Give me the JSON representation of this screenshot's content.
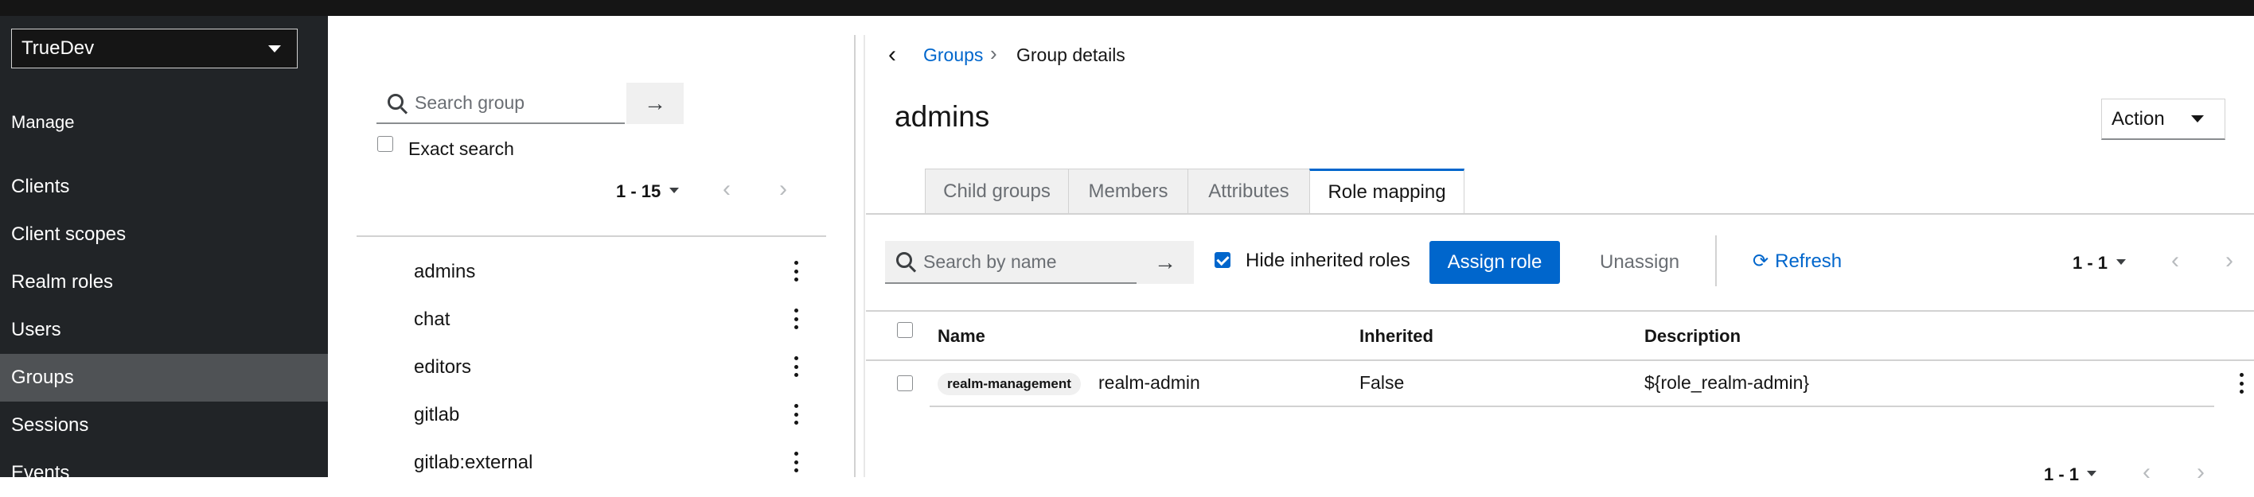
{
  "realm": {
    "selected": "TrueDev"
  },
  "sidebar": {
    "section": "Manage",
    "items": [
      {
        "label": "Clients"
      },
      {
        "label": "Client scopes"
      },
      {
        "label": "Realm roles"
      },
      {
        "label": "Users"
      },
      {
        "label": "Groups"
      },
      {
        "label": "Sessions"
      },
      {
        "label": "Events"
      }
    ]
  },
  "tree": {
    "search_placeholder": "Search group",
    "exact_search_label": "Exact search",
    "pagination": "1 - 15",
    "items": [
      {
        "label": "admins"
      },
      {
        "label": "chat"
      },
      {
        "label": "editors"
      },
      {
        "label": "gitlab"
      },
      {
        "label": "gitlab:external"
      }
    ]
  },
  "breadcrumb": {
    "parent": "Groups",
    "current": "Group details"
  },
  "details": {
    "title": "admins",
    "action_label": "Action",
    "tabs": [
      {
        "label": "Child groups"
      },
      {
        "label": "Members"
      },
      {
        "label": "Attributes"
      },
      {
        "label": "Role mapping"
      }
    ],
    "active_tab": "Role mapping"
  },
  "role_mapping": {
    "search_placeholder": "Search by name",
    "hide_inherited_label": "Hide inherited roles",
    "hide_inherited_checked": true,
    "assign_label": "Assign role",
    "unassign_label": "Unassign",
    "refresh_label": "Refresh",
    "pagination": "1 - 1",
    "columns": [
      "Name",
      "Inherited",
      "Description"
    ],
    "rows": [
      {
        "client": "realm-management",
        "name": "realm-admin",
        "inherited": "False",
        "description": "${role_realm-admin}"
      }
    ],
    "footer_pagination": "1 - 1"
  },
  "colors": {
    "accent": "#0066cc",
    "sidebar": "#212427",
    "sidebar_active": "#4f5255"
  }
}
